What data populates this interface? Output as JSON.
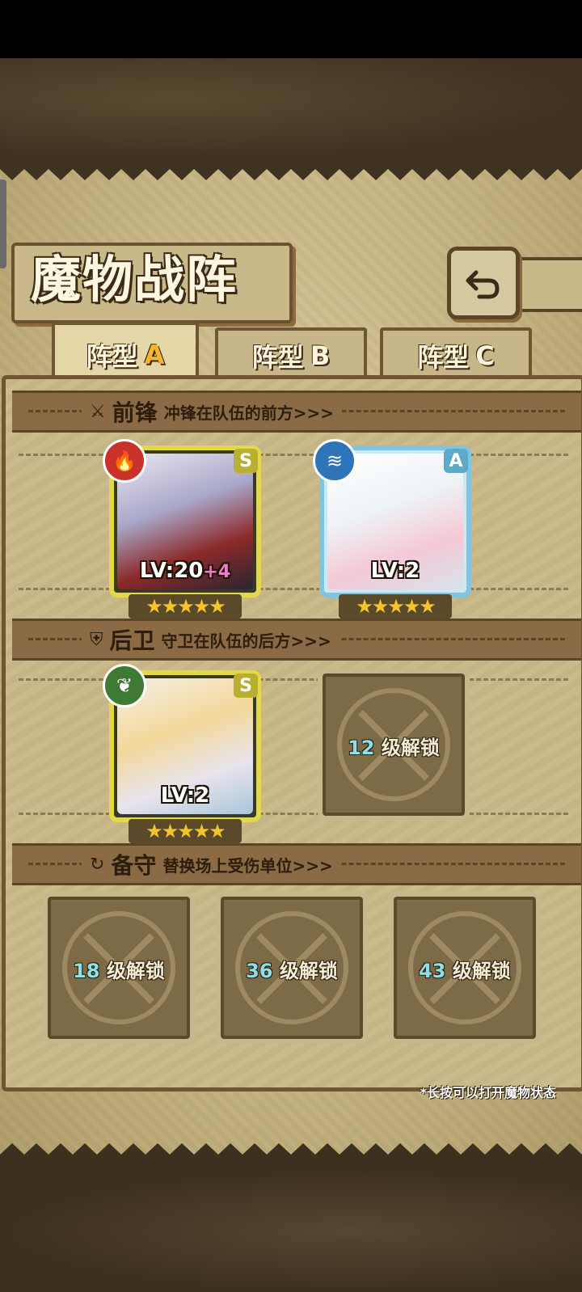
{
  "title": "魔物战阵",
  "back_icon": "return-arrow-icon",
  "tabs": [
    {
      "label": "阵型",
      "letter": "A",
      "active": true
    },
    {
      "label": "阵型",
      "letter": "B",
      "active": false
    },
    {
      "label": "阵型",
      "letter": "C",
      "active": false
    }
  ],
  "sections": {
    "front": {
      "title": "前锋",
      "subtitle": "冲锋在队伍的前方>>>",
      "icon": "sword-icon"
    },
    "back": {
      "title": "后卫",
      "subtitle": "守卫在队伍的后方>>>",
      "icon": "shield-icon"
    },
    "reserve": {
      "title": "备守",
      "subtitle": "替换场上受伤单位>>>",
      "icon": "swap-icon"
    }
  },
  "front_cards": [
    {
      "rank": "S",
      "element": "fire-icon",
      "level": "LV:20",
      "bonus": "+4",
      "stars": "★★★★★",
      "element_color": "#c8322a"
    },
    {
      "rank": "A",
      "element": "water-icon",
      "level": "LV:2",
      "bonus": "",
      "stars": "★★★★★",
      "element_color": "#2d74b8"
    }
  ],
  "back_cards": [
    {
      "rank": "S",
      "element": "leaf-icon",
      "level": "LV:2",
      "bonus": "",
      "stars": "★★★★★",
      "element_color": "#3f7a35"
    }
  ],
  "locked_slots": {
    "back_slot": {
      "level": "12",
      "text": "级解锁"
    },
    "reserve": [
      {
        "level": "18",
        "text": "级解锁"
      },
      {
        "level": "36",
        "text": "级解锁"
      },
      {
        "level": "43",
        "text": "级解锁"
      }
    ]
  },
  "hint": "*长按可以打开魔物状态"
}
